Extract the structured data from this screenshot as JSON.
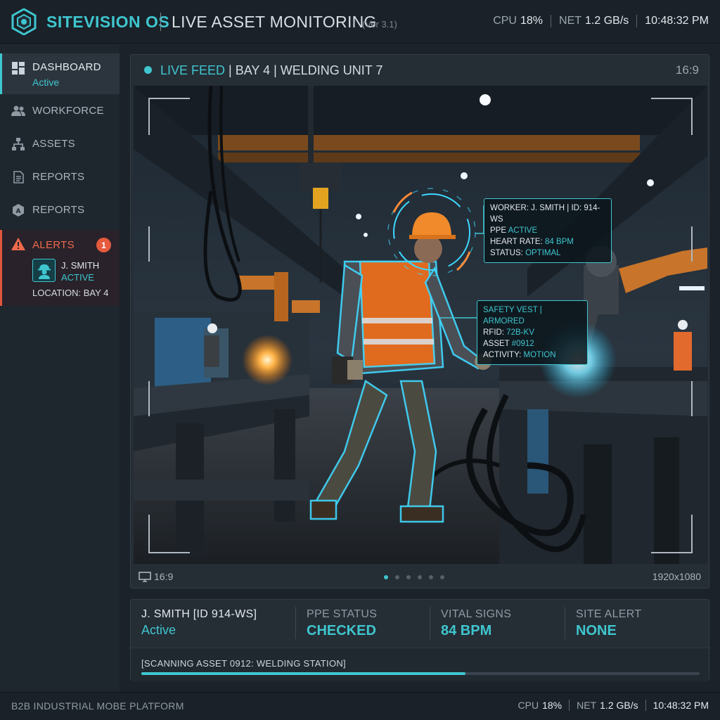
{
  "app": {
    "brand": "SITEVISION OS",
    "title": "LIVE ASSET MONITORING",
    "version": "(Ver 3.1)"
  },
  "header": {
    "cpu_label": "CPU",
    "cpu_value": "18%",
    "net_label": "NET",
    "net_value": "1.2 GB/s",
    "time": "10:48:32 PM"
  },
  "sidebar": {
    "items": [
      {
        "label": "DASHBOARD",
        "sub": "Active",
        "icon": "dashboard-icon"
      },
      {
        "label": "WORKFORCE",
        "icon": "workforce-icon"
      },
      {
        "label": "ASSETS",
        "icon": "assets-icon"
      },
      {
        "label": "REPORTS",
        "icon": "reports-icon"
      },
      {
        "label": "REPORTS",
        "icon": "reports-alt-icon"
      }
    ],
    "alerts": {
      "label": "ALERTS",
      "count": "1",
      "person_name": "J. SMITH",
      "person_status": "ACTIVE",
      "location": "LOCATION: BAY 4"
    }
  },
  "feed": {
    "live_label": "LIVE FEED",
    "title_rest": "| BAY 4 | WELDING UNIT 7",
    "ratio": "16:9",
    "footer_ratio": "16:9",
    "resolution": "1920x1080",
    "page_dots": 6,
    "active_dot": 0,
    "worker_tag": {
      "line1_label": "WORKER:",
      "line1_value": "J. SMITH | ID: 914-WS",
      "line2_label": "PPE",
      "line2_value": "ACTIVE",
      "line3_label": "HEART RATE:",
      "line3_value": "84 BPM",
      "line4_label": "STATUS:",
      "line4_value": "OPTIMAL"
    },
    "vest_tag": {
      "line1": "SAFETY VEST | ARMORED",
      "line2_label": "RFID:",
      "line2_value": "72B-KV",
      "line3_label": "ASSET",
      "line3_value": "#0912",
      "line4_label": "ACTIVITY:",
      "line4_value": "MOTION"
    }
  },
  "status": {
    "worker": "J. SMITH [ID 914-WS]",
    "worker_status": "Active",
    "ppe_label": "PPE STATUS",
    "ppe_value": "CHECKED",
    "vitals_label": "VITAL SIGNS",
    "vitals_value": "84 BPM",
    "alert_label": "SITE ALERT",
    "alert_value": "NONE",
    "scan_text": "[SCANNING ASSET 0912: WELDING STATION]",
    "scan_progress": 0.58
  },
  "footer": {
    "platform": "B2B INDUSTRIAL MOBE PLATFORM",
    "cpu_label": "CPU",
    "cpu_value": "18%",
    "net_label": "NET",
    "net_value": "1.2 GB/s",
    "time": "10:48:32 PM"
  },
  "colors": {
    "accent": "#3fc6cf",
    "alert": "#e65a3e",
    "background": "#1b222a"
  }
}
